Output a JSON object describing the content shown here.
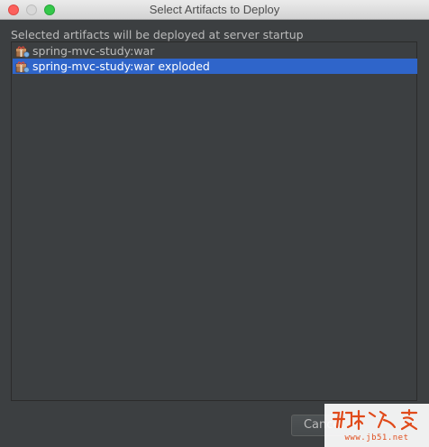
{
  "window": {
    "title": "Select Artifacts to Deploy",
    "controls": [
      "close",
      "minimize",
      "zoom"
    ]
  },
  "description": "Selected artifacts will be deployed at server startup",
  "artifacts": [
    {
      "label": "spring-mvc-study:war",
      "icon": "artifact-icon",
      "selected": false
    },
    {
      "label": "spring-mvc-study:war exploded",
      "icon": "artifact-icon",
      "selected": true
    }
  ],
  "buttons": {
    "cancel": "Cancel"
  },
  "watermark": {
    "logo": "脚本之家",
    "url": "www.jb51.net"
  },
  "colors": {
    "background": "#3c3f41",
    "selection": "#2f65ca",
    "text": "#bbbbbb"
  }
}
